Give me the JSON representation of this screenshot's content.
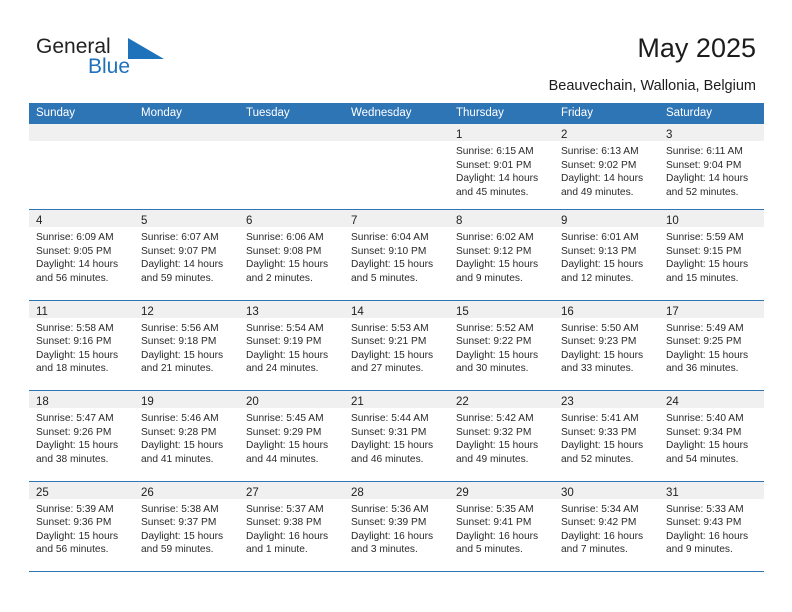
{
  "brand": {
    "name_part1": "General",
    "name_part2": "Blue",
    "mark": "triangle-logo-icon",
    "accent_color": "#1d72bb"
  },
  "header": {
    "title": "May 2025",
    "subtitle": "Beauvechain, Wallonia, Belgium"
  },
  "calendar": {
    "header_bg": "#2e75b6",
    "daynum_bg": "#f0f0f0",
    "weekdays": [
      "Sunday",
      "Monday",
      "Tuesday",
      "Wednesday",
      "Thursday",
      "Friday",
      "Saturday"
    ],
    "weeks": [
      [
        {
          "day": "",
          "empty": true,
          "lines": []
        },
        {
          "day": "",
          "empty": true,
          "lines": []
        },
        {
          "day": "",
          "empty": true,
          "lines": []
        },
        {
          "day": "",
          "empty": true,
          "lines": []
        },
        {
          "day": "1",
          "empty": false,
          "lines": [
            "Sunrise: 6:15 AM",
            "Sunset: 9:01 PM",
            "Daylight: 14 hours",
            "and 45 minutes."
          ]
        },
        {
          "day": "2",
          "empty": false,
          "lines": [
            "Sunrise: 6:13 AM",
            "Sunset: 9:02 PM",
            "Daylight: 14 hours",
            "and 49 minutes."
          ]
        },
        {
          "day": "3",
          "empty": false,
          "lines": [
            "Sunrise: 6:11 AM",
            "Sunset: 9:04 PM",
            "Daylight: 14 hours",
            "and 52 minutes."
          ]
        }
      ],
      [
        {
          "day": "4",
          "empty": false,
          "lines": [
            "Sunrise: 6:09 AM",
            "Sunset: 9:05 PM",
            "Daylight: 14 hours",
            "and 56 minutes."
          ]
        },
        {
          "day": "5",
          "empty": false,
          "lines": [
            "Sunrise: 6:07 AM",
            "Sunset: 9:07 PM",
            "Daylight: 14 hours",
            "and 59 minutes."
          ]
        },
        {
          "day": "6",
          "empty": false,
          "lines": [
            "Sunrise: 6:06 AM",
            "Sunset: 9:08 PM",
            "Daylight: 15 hours",
            "and 2 minutes."
          ]
        },
        {
          "day": "7",
          "empty": false,
          "lines": [
            "Sunrise: 6:04 AM",
            "Sunset: 9:10 PM",
            "Daylight: 15 hours",
            "and 5 minutes."
          ]
        },
        {
          "day": "8",
          "empty": false,
          "lines": [
            "Sunrise: 6:02 AM",
            "Sunset: 9:12 PM",
            "Daylight: 15 hours",
            "and 9 minutes."
          ]
        },
        {
          "day": "9",
          "empty": false,
          "lines": [
            "Sunrise: 6:01 AM",
            "Sunset: 9:13 PM",
            "Daylight: 15 hours",
            "and 12 minutes."
          ]
        },
        {
          "day": "10",
          "empty": false,
          "lines": [
            "Sunrise: 5:59 AM",
            "Sunset: 9:15 PM",
            "Daylight: 15 hours",
            "and 15 minutes."
          ]
        }
      ],
      [
        {
          "day": "11",
          "empty": false,
          "lines": [
            "Sunrise: 5:58 AM",
            "Sunset: 9:16 PM",
            "Daylight: 15 hours",
            "and 18 minutes."
          ]
        },
        {
          "day": "12",
          "empty": false,
          "lines": [
            "Sunrise: 5:56 AM",
            "Sunset: 9:18 PM",
            "Daylight: 15 hours",
            "and 21 minutes."
          ]
        },
        {
          "day": "13",
          "empty": false,
          "lines": [
            "Sunrise: 5:54 AM",
            "Sunset: 9:19 PM",
            "Daylight: 15 hours",
            "and 24 minutes."
          ]
        },
        {
          "day": "14",
          "empty": false,
          "lines": [
            "Sunrise: 5:53 AM",
            "Sunset: 9:21 PM",
            "Daylight: 15 hours",
            "and 27 minutes."
          ]
        },
        {
          "day": "15",
          "empty": false,
          "lines": [
            "Sunrise: 5:52 AM",
            "Sunset: 9:22 PM",
            "Daylight: 15 hours",
            "and 30 minutes."
          ]
        },
        {
          "day": "16",
          "empty": false,
          "lines": [
            "Sunrise: 5:50 AM",
            "Sunset: 9:23 PM",
            "Daylight: 15 hours",
            "and 33 minutes."
          ]
        },
        {
          "day": "17",
          "empty": false,
          "lines": [
            "Sunrise: 5:49 AM",
            "Sunset: 9:25 PM",
            "Daylight: 15 hours",
            "and 36 minutes."
          ]
        }
      ],
      [
        {
          "day": "18",
          "empty": false,
          "lines": [
            "Sunrise: 5:47 AM",
            "Sunset: 9:26 PM",
            "Daylight: 15 hours",
            "and 38 minutes."
          ]
        },
        {
          "day": "19",
          "empty": false,
          "lines": [
            "Sunrise: 5:46 AM",
            "Sunset: 9:28 PM",
            "Daylight: 15 hours",
            "and 41 minutes."
          ]
        },
        {
          "day": "20",
          "empty": false,
          "lines": [
            "Sunrise: 5:45 AM",
            "Sunset: 9:29 PM",
            "Daylight: 15 hours",
            "and 44 minutes."
          ]
        },
        {
          "day": "21",
          "empty": false,
          "lines": [
            "Sunrise: 5:44 AM",
            "Sunset: 9:31 PM",
            "Daylight: 15 hours",
            "and 46 minutes."
          ]
        },
        {
          "day": "22",
          "empty": false,
          "lines": [
            "Sunrise: 5:42 AM",
            "Sunset: 9:32 PM",
            "Daylight: 15 hours",
            "and 49 minutes."
          ]
        },
        {
          "day": "23",
          "empty": false,
          "lines": [
            "Sunrise: 5:41 AM",
            "Sunset: 9:33 PM",
            "Daylight: 15 hours",
            "and 52 minutes."
          ]
        },
        {
          "day": "24",
          "empty": false,
          "lines": [
            "Sunrise: 5:40 AM",
            "Sunset: 9:34 PM",
            "Daylight: 15 hours",
            "and 54 minutes."
          ]
        }
      ],
      [
        {
          "day": "25",
          "empty": false,
          "lines": [
            "Sunrise: 5:39 AM",
            "Sunset: 9:36 PM",
            "Daylight: 15 hours",
            "and 56 minutes."
          ]
        },
        {
          "day": "26",
          "empty": false,
          "lines": [
            "Sunrise: 5:38 AM",
            "Sunset: 9:37 PM",
            "Daylight: 15 hours",
            "and 59 minutes."
          ]
        },
        {
          "day": "27",
          "empty": false,
          "lines": [
            "Sunrise: 5:37 AM",
            "Sunset: 9:38 PM",
            "Daylight: 16 hours",
            "and 1 minute."
          ]
        },
        {
          "day": "28",
          "empty": false,
          "lines": [
            "Sunrise: 5:36 AM",
            "Sunset: 9:39 PM",
            "Daylight: 16 hours",
            "and 3 minutes."
          ]
        },
        {
          "day": "29",
          "empty": false,
          "lines": [
            "Sunrise: 5:35 AM",
            "Sunset: 9:41 PM",
            "Daylight: 16 hours",
            "and 5 minutes."
          ]
        },
        {
          "day": "30",
          "empty": false,
          "lines": [
            "Sunrise: 5:34 AM",
            "Sunset: 9:42 PM",
            "Daylight: 16 hours",
            "and 7 minutes."
          ]
        },
        {
          "day": "31",
          "empty": false,
          "lines": [
            "Sunrise: 5:33 AM",
            "Sunset: 9:43 PM",
            "Daylight: 16 hours",
            "and 9 minutes."
          ]
        }
      ]
    ]
  }
}
